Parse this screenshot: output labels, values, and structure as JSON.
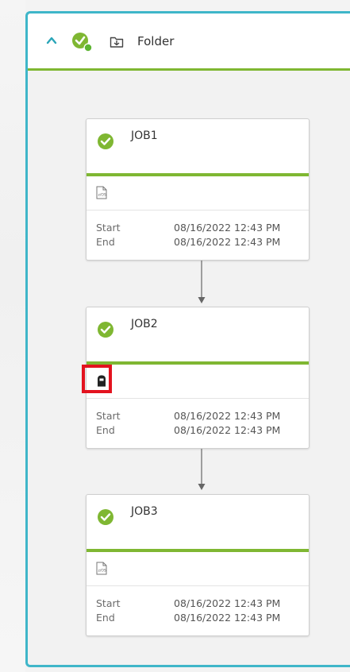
{
  "folder": {
    "title": "Folder",
    "accent": "#3fb6c9",
    "status_color": "#7fb732"
  },
  "jobs": [
    {
      "name": "JOB1",
      "type_icon": "script-file-icon",
      "start_label": "Start",
      "start_value": "08/16/2022 12:43 PM",
      "end_label": "End",
      "end_value": "08/16/2022 12:43 PM"
    },
    {
      "name": "JOB2",
      "type_icon": "dummy-job-icon",
      "start_label": "Start",
      "start_value": "08/16/2022 12:43 PM",
      "end_label": "End",
      "end_value": "08/16/2022 12:43 PM"
    },
    {
      "name": "JOB3",
      "type_icon": "script-file-icon",
      "start_label": "Start",
      "start_value": "08/16/2022 12:43 PM",
      "end_label": "End",
      "end_value": "08/16/2022 12:43 PM"
    }
  ],
  "colors": {
    "success": "#7fb732",
    "highlight": "#e3131f"
  }
}
